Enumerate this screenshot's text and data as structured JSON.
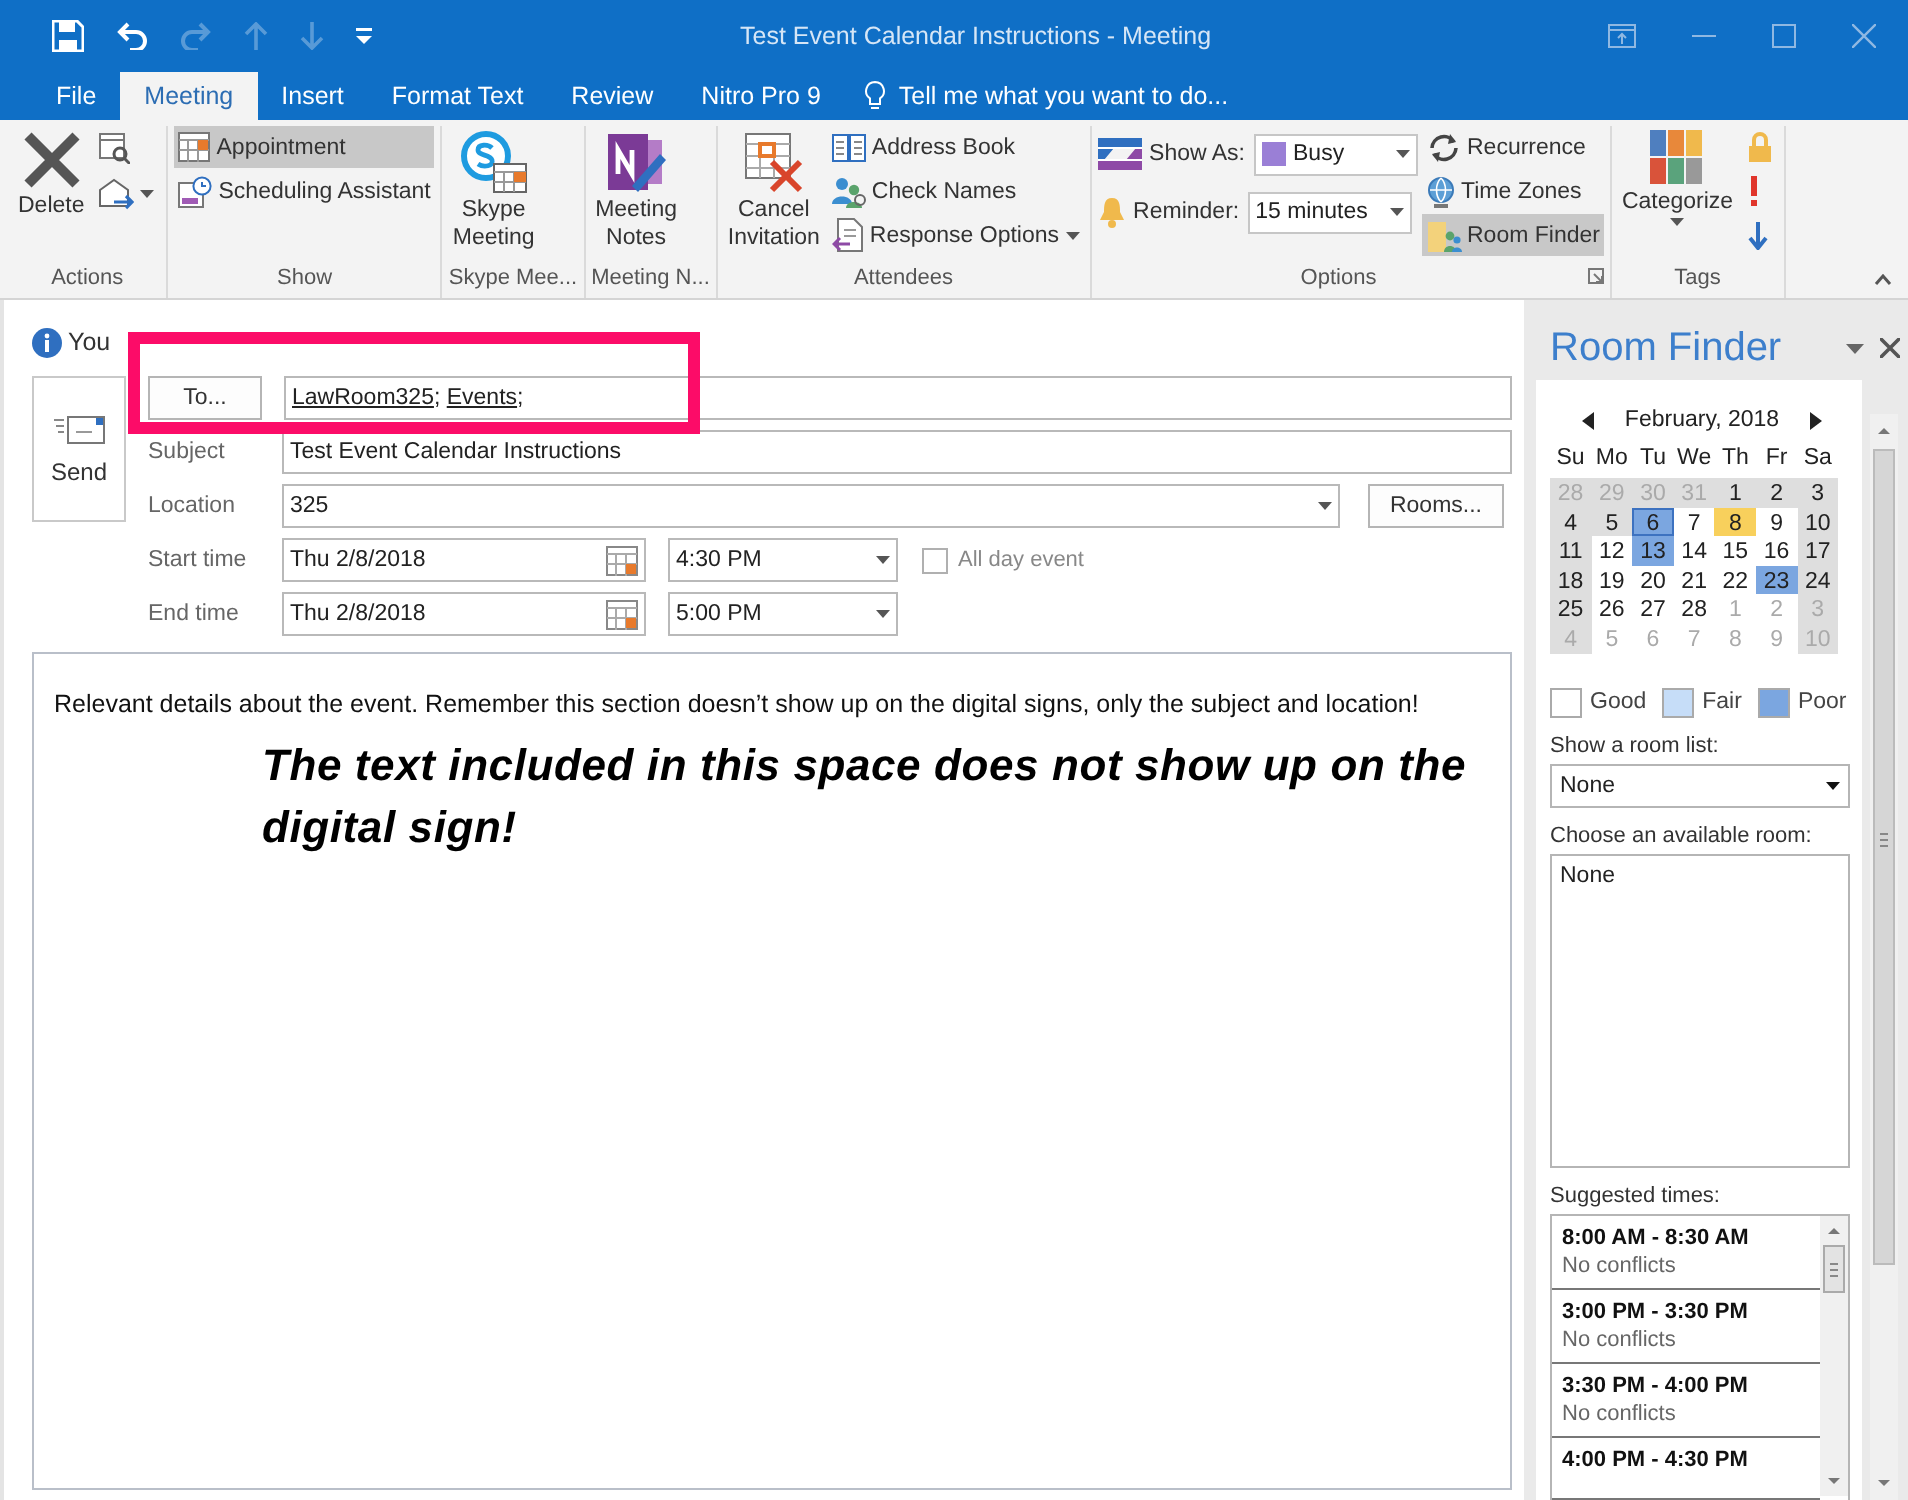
{
  "window": {
    "title": "Test Event Calendar Instructions - Meeting"
  },
  "quick_access": [
    {
      "disabled": false
    },
    {
      "disabled": false
    },
    {
      "disabled": true
    },
    {
      "disabled": true
    },
    {
      "disabled": true
    },
    {
      "disabled": false
    }
  ],
  "tabs": [
    {
      "label": "File",
      "selected": false
    },
    {
      "label": "Meeting",
      "selected": true
    },
    {
      "label": "Insert",
      "selected": false
    },
    {
      "label": "Format Text",
      "selected": false
    },
    {
      "label": "Review",
      "selected": false
    },
    {
      "label": "Nitro Pro 9",
      "selected": false
    }
  ],
  "tell_me": {
    "placeholder": "Tell me what you want to do..."
  },
  "ribbon": {
    "groups": [
      {
        "label": "Actions",
        "columns": [
          [
            {
              "kind": "large",
              "label": "Delete",
              "selected": false
            }
          ],
          [
            {
              "kind": "icon"
            },
            {
              "kind": "icon",
              "dropdown": true
            }
          ]
        ]
      },
      {
        "label": "Show",
        "columns": [
          [
            {
              "kind": "small",
              "label": "Appointment",
              "selected": true
            },
            {
              "kind": "small",
              "label": "Scheduling Assistant",
              "selected": false
            }
          ]
        ]
      },
      {
        "label": "Skype Mee...",
        "columns": [
          [
            {
              "kind": "large",
              "label": "Skype Meeting",
              "selected": false
            }
          ]
        ]
      },
      {
        "label": "Meeting N...",
        "columns": [
          [
            {
              "kind": "large",
              "label": "Meeting Notes",
              "selected": false
            }
          ]
        ]
      },
      {
        "label": "Attendees",
        "columns": [
          [
            {
              "kind": "large",
              "label": "Cancel Invitation",
              "selected": false
            }
          ],
          [
            {
              "kind": "small",
              "label": "Address Book",
              "selected": false
            },
            {
              "kind": "small",
              "label": "Check Names",
              "selected": false
            },
            {
              "kind": "small",
              "label": "Response Options",
              "selected": false,
              "dropdown": true
            }
          ]
        ]
      },
      {
        "label": "Options",
        "launcher": true,
        "columns": [
          [
            {
              "kind": "field",
              "label": "Show As:",
              "value": "Busy",
              "color": "#9a7fd6"
            },
            {
              "kind": "field",
              "label": "Reminder:",
              "value": "15 minutes"
            }
          ],
          [
            {
              "kind": "small",
              "label": "Recurrence",
              "selected": false
            },
            {
              "kind": "small",
              "label": "Time Zones",
              "selected": false
            },
            {
              "kind": "small",
              "label": "Room Finder",
              "selected": true
            }
          ]
        ]
      },
      {
        "label": "Tags",
        "columns": [
          [
            {
              "kind": "large",
              "label": "Categorize",
              "selected": false,
              "dropdown": true
            }
          ],
          [
            {
              "kind": "icon"
            },
            {
              "kind": "icon"
            },
            {
              "kind": "icon"
            }
          ]
        ]
      }
    ]
  },
  "info_bar": {
    "text": "You"
  },
  "form": {
    "send": "Send",
    "to_button": "To...",
    "recipients": [
      {
        "name": "LawRoom325",
        "suffix": ";"
      },
      {
        "name": "Events",
        "suffix": ";"
      }
    ],
    "subject": {
      "label": "Subject",
      "value": "Test Event Calendar Instructions"
    },
    "location": {
      "label": "Location",
      "value": "325",
      "button": "Rooms..."
    },
    "start": {
      "label": "Start time",
      "date": "Thu 2/8/2018",
      "time": "4:30 PM"
    },
    "all_day": {
      "label": "All day event",
      "checked": false
    },
    "end": {
      "label": "End time",
      "date": "Thu 2/8/2018",
      "time": "5:00 PM"
    },
    "body": "Relevant details about the event. Remember this section doesn’t show up on the digital signs, only the subject and location!"
  },
  "annotation": {
    "text": "The text included in this space does not show up on the digital sign!"
  },
  "room_finder": {
    "title": "Room Finder",
    "month": "February, 2018",
    "weekdays": [
      "Su",
      "Mo",
      "Tu",
      "We",
      "Th",
      "Fr",
      "Sa"
    ],
    "weeks": [
      [
        {
          "d": "28",
          "muted": true,
          "kind": "unavailable",
          "today": false,
          "selected": false
        },
        {
          "d": "29",
          "muted": true,
          "kind": "unavailable",
          "today": false,
          "selected": false
        },
        {
          "d": "30",
          "muted": true,
          "kind": "unavailable",
          "today": false,
          "selected": false
        },
        {
          "d": "31",
          "muted": true,
          "kind": "unavailable",
          "today": false,
          "selected": false
        },
        {
          "d": "1",
          "muted": false,
          "kind": "unavailable",
          "today": false,
          "selected": false
        },
        {
          "d": "2",
          "muted": false,
          "kind": "unavailable",
          "today": false,
          "selected": false
        },
        {
          "d": "3",
          "muted": false,
          "kind": "unavailable",
          "today": false,
          "selected": false
        }
      ],
      [
        {
          "d": "4",
          "muted": false,
          "kind": "unavailable",
          "today": false,
          "selected": false
        },
        {
          "d": "5",
          "muted": false,
          "kind": "unavailable",
          "today": false,
          "selected": false
        },
        {
          "d": "6",
          "muted": false,
          "kind": "poor",
          "today": true,
          "selected": false
        },
        {
          "d": "7",
          "muted": false,
          "kind": "free",
          "today": false,
          "selected": false
        },
        {
          "d": "8",
          "muted": false,
          "kind": "free",
          "today": false,
          "selected": true
        },
        {
          "d": "9",
          "muted": false,
          "kind": "free",
          "today": false,
          "selected": false
        },
        {
          "d": "10",
          "muted": false,
          "kind": "unavailable",
          "today": false,
          "selected": false
        }
      ],
      [
        {
          "d": "11",
          "muted": false,
          "kind": "unavailable",
          "today": false,
          "selected": false
        },
        {
          "d": "12",
          "muted": false,
          "kind": "free",
          "today": false,
          "selected": false
        },
        {
          "d": "13",
          "muted": false,
          "kind": "poor",
          "today": false,
          "selected": false
        },
        {
          "d": "14",
          "muted": false,
          "kind": "free",
          "today": false,
          "selected": false
        },
        {
          "d": "15",
          "muted": false,
          "kind": "free",
          "today": false,
          "selected": false
        },
        {
          "d": "16",
          "muted": false,
          "kind": "free",
          "today": false,
          "selected": false
        },
        {
          "d": "17",
          "muted": false,
          "kind": "unavailable",
          "today": false,
          "selected": false
        }
      ],
      [
        {
          "d": "18",
          "muted": false,
          "kind": "unavailable",
          "today": false,
          "selected": false
        },
        {
          "d": "19",
          "muted": false,
          "kind": "free",
          "today": false,
          "selected": false
        },
        {
          "d": "20",
          "muted": false,
          "kind": "free",
          "today": false,
          "selected": false
        },
        {
          "d": "21",
          "muted": false,
          "kind": "free",
          "today": false,
          "selected": false
        },
        {
          "d": "22",
          "muted": false,
          "kind": "free",
          "today": false,
          "selected": false
        },
        {
          "d": "23",
          "muted": false,
          "kind": "poor",
          "today": false,
          "selected": false
        },
        {
          "d": "24",
          "muted": false,
          "kind": "unavailable",
          "today": false,
          "selected": false
        }
      ],
      [
        {
          "d": "25",
          "muted": false,
          "kind": "unavailable",
          "today": false,
          "selected": false
        },
        {
          "d": "26",
          "muted": false,
          "kind": "free",
          "today": false,
          "selected": false
        },
        {
          "d": "27",
          "muted": false,
          "kind": "free",
          "today": false,
          "selected": false
        },
        {
          "d": "28",
          "muted": false,
          "kind": "free",
          "today": false,
          "selected": false
        },
        {
          "d": "1",
          "muted": true,
          "kind": "free",
          "today": false,
          "selected": false
        },
        {
          "d": "2",
          "muted": true,
          "kind": "free",
          "today": false,
          "selected": false
        },
        {
          "d": "3",
          "muted": true,
          "kind": "unavailable",
          "today": false,
          "selected": false
        }
      ],
      [
        {
          "d": "4",
          "muted": true,
          "kind": "unavailable",
          "today": false,
          "selected": false
        },
        {
          "d": "5",
          "muted": true,
          "kind": "free",
          "today": false,
          "selected": false
        },
        {
          "d": "6",
          "muted": true,
          "kind": "free",
          "today": false,
          "selected": false
        },
        {
          "d": "7",
          "muted": true,
          "kind": "free",
          "today": false,
          "selected": false
        },
        {
          "d": "8",
          "muted": true,
          "kind": "free",
          "today": false,
          "selected": false
        },
        {
          "d": "9",
          "muted": true,
          "kind": "free",
          "today": false,
          "selected": false
        },
        {
          "d": "10",
          "muted": true,
          "kind": "unavailable",
          "today": false,
          "selected": false
        }
      ]
    ],
    "legend": [
      {
        "label": "Good",
        "color": "#ffffff"
      },
      {
        "label": "Fair",
        "color": "#c6ddf8"
      },
      {
        "label": "Poor",
        "color": "#7ba6e0"
      }
    ],
    "room_list": {
      "label": "Show a room list:",
      "value": "None"
    },
    "rooms": {
      "label": "Choose an available room:",
      "items": [
        "None"
      ]
    },
    "suggested": {
      "label": "Suggested times:",
      "items": [
        {
          "time": "8:00 AM - 8:30 AM",
          "note": "No conflicts"
        },
        {
          "time": "3:00 PM - 3:30 PM",
          "note": "No conflicts"
        },
        {
          "time": "3:30 PM - 4:00 PM",
          "note": "No conflicts"
        },
        {
          "time": "4:00 PM - 4:30 PM"
        }
      ]
    }
  }
}
